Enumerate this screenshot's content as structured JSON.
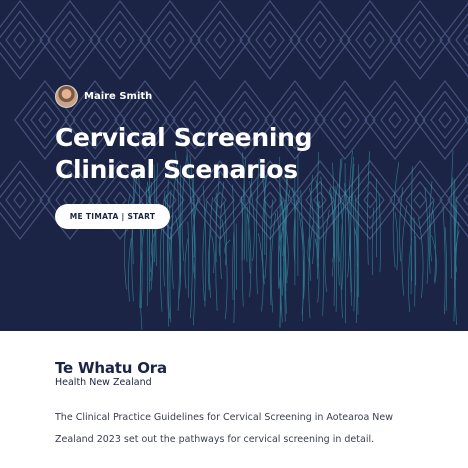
{
  "hero": {
    "author": {
      "name": "Maire Smith"
    },
    "title_line1": "Cervical Screening",
    "title_line2": "Clinical Scenarios",
    "start_button_label": "ME TIMATA | START"
  },
  "content": {
    "logo_title": "Te Whatu Ora",
    "logo_subtitle": "Health New Zealand",
    "intro_line1": "The Clinical Practice Guidelines for Cervical Screening in Aotearoa New",
    "intro_line2": "Zealand 2023 set out the pathways for cervical screening in detail."
  },
  "colors": {
    "hero_background": "#1b2444",
    "pattern": "#4a5a86",
    "threads": "#3fb8c8",
    "text_dark": "#1b2444"
  }
}
